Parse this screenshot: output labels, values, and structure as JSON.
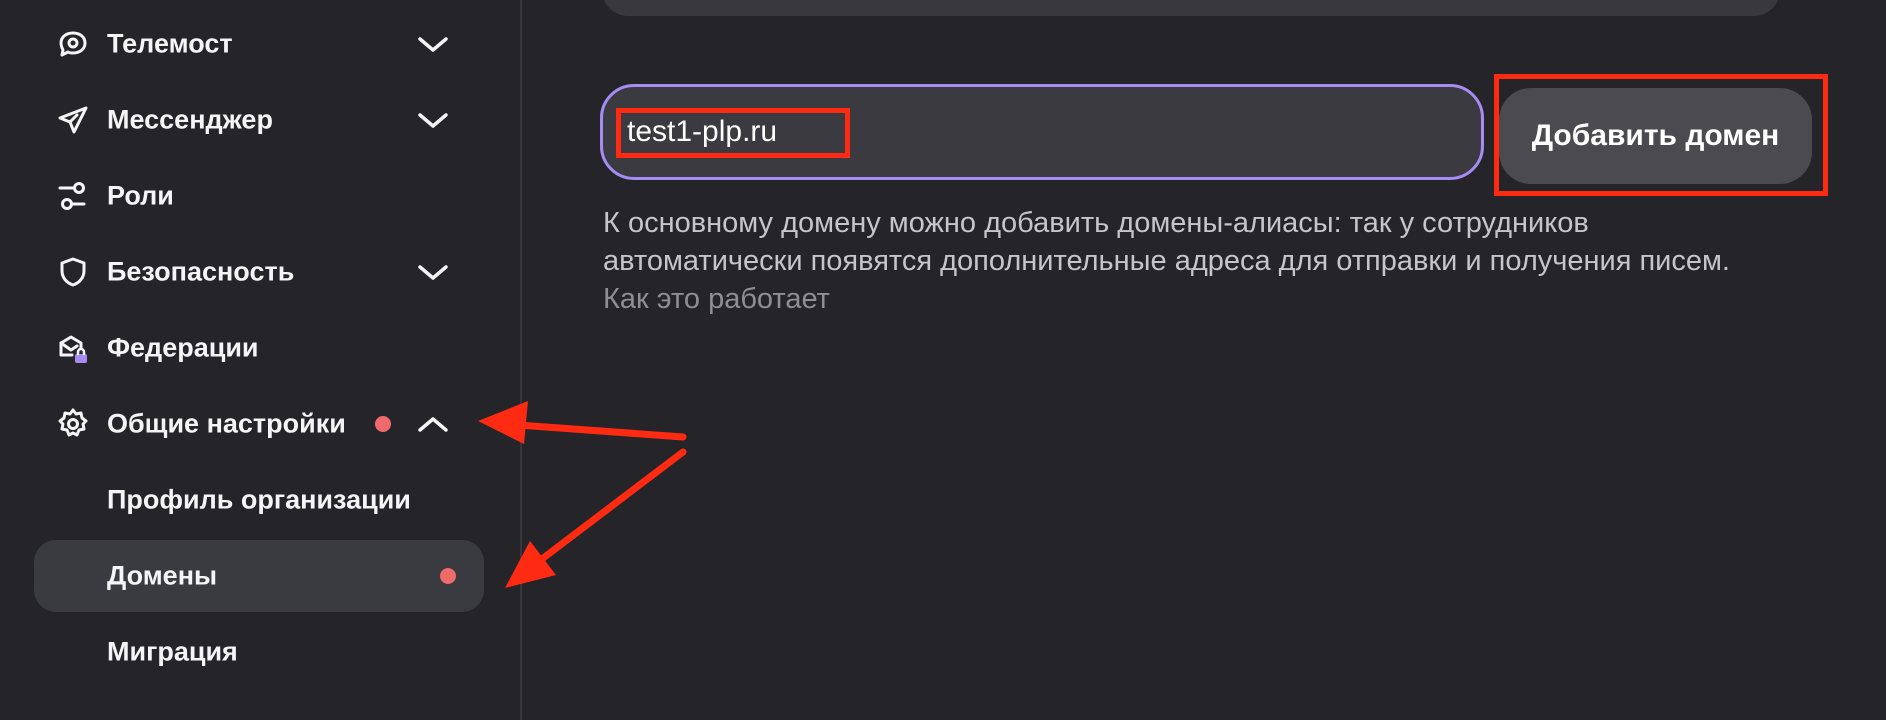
{
  "sidebar": {
    "items": [
      {
        "label": "Телемост",
        "icon": "telemost-icon",
        "chevron": "down"
      },
      {
        "label": "Мессенджер",
        "icon": "messenger-icon",
        "chevron": "down"
      },
      {
        "label": "Роли",
        "icon": "roles-icon"
      },
      {
        "label": "Безопасность",
        "icon": "shield-icon",
        "chevron": "down"
      },
      {
        "label": "Федерации",
        "icon": "federation-lock-icon"
      },
      {
        "label": "Общие настройки",
        "icon": "gear-icon",
        "chevron": "up",
        "badge": true
      },
      {
        "label": "Профиль организации"
      },
      {
        "label": "Домены",
        "active": true,
        "badge": true
      },
      {
        "label": "Миграция"
      }
    ]
  },
  "main": {
    "domain_input": {
      "value": "test1-plp.ru"
    },
    "add_button": {
      "label": "Добавить домен"
    },
    "hint": {
      "text": "К основному домену можно добавить домены-алиасы: так у сотрудников автоматически появятся дополнительные адреса для отправки и получения писем. ",
      "link": "Как это работает"
    }
  },
  "colors": {
    "background": "#242429",
    "accent_border": "#a58cf2",
    "badge": "#ef6a6a",
    "annotation": "#ff2a12"
  }
}
